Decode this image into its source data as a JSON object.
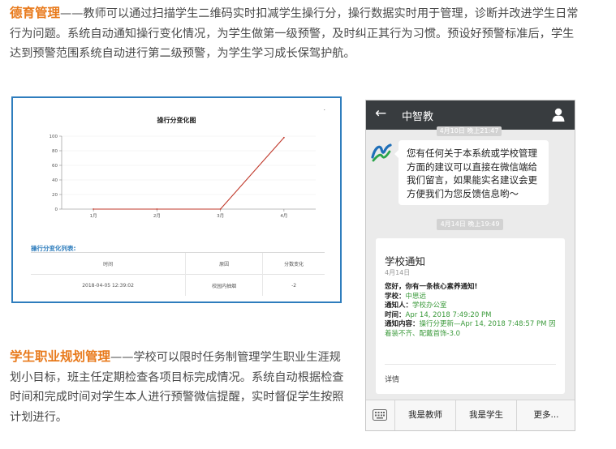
{
  "intro": {
    "heading": "德育管理",
    "text": "——教师可以通过扫描学生二维码实时扣减学生操行分，操行数据实时用于管理，诊断并改进学生日常行为问题。系统自动通知操行变化情况，为学生做第一级预警，及时纠正其行为习惯。预设好预警标准后，学生达到预警范围系统自动进行第二级预警，为学生学习成长保驾护航。"
  },
  "career": {
    "heading": "学生职业规划管理",
    "text": "——学校可以限时任务制管理学生职业生涯规划小目标，班主任定期检查各项目标完成情况。系统自动根据检查时间和完成时间对学生本人进行预警微信提醒，实时督促学生按照计划进行。"
  },
  "chart_data": {
    "type": "line",
    "title": "操行分变化图",
    "categories": [
      "1月",
      "2月",
      "3月",
      "4月"
    ],
    "y_ticks": [
      "0",
      "20",
      "40",
      "60",
      "80",
      "100"
    ],
    "values": [
      0,
      0,
      0,
      98
    ],
    "ylim": [
      0,
      100
    ],
    "grid": true,
    "line_color": "#c0392b",
    "corner_mark": "."
  },
  "score_list": {
    "title": "操行分变化列表:",
    "columns": [
      "时间",
      "原因",
      "分数变化"
    ],
    "rows": [
      [
        "2018-04-05 12:39:02",
        "校园内抽烟",
        "-2"
      ]
    ]
  },
  "phone": {
    "title": "中智教",
    "timestamp_top": "4月10日 晚上21:47",
    "bubble_text": "您有任何关于本系统或学校管理方面的建议可以直接在微信端给我们留言，如果能实名建议会更方便我们为您反馈信息哟～",
    "timestamp_2": "4月14日 晚上19:49",
    "card": {
      "title": "学校通知",
      "date": "4月14日",
      "greeting": "您好，你有一条核心素养通知!",
      "school_label": "学校：",
      "school_value": "中思远",
      "notifier_label": "通知人：",
      "notifier_value": "学校办公室",
      "time_label": "时间：",
      "time_value": "Apr 14, 2018 7:49:20 PM",
      "content_label": "通知内容：",
      "content_value": "操行分更新—Apr 14, 2018 7:48:57 PM 因着装不齐、配戴首饰-3.0",
      "detail": "详情"
    },
    "menu": {
      "teacher": "我是教师",
      "student": "我是学生",
      "more": "更多..."
    },
    "colors": {
      "topbar": "#383c3f",
      "accent_green": "#3b9a3b"
    },
    "icons": [
      "back-arrow-icon",
      "user-icon",
      "keyboard-icon"
    ]
  }
}
